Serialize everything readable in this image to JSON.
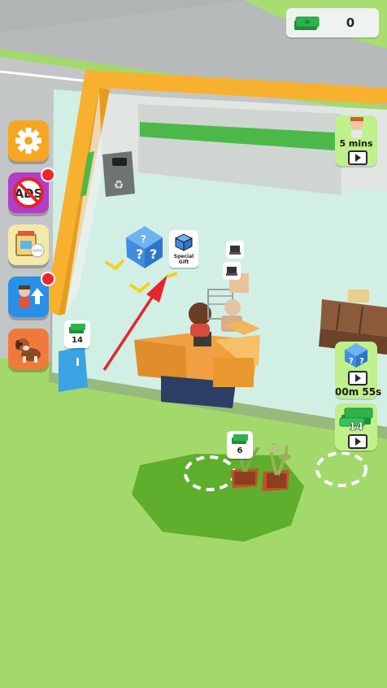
{
  "hud": {
    "cash_amount": "0",
    "cash_icon": "cash-stack-icon"
  },
  "side_menu": [
    {
      "id": "settings",
      "icon": "gear-icon",
      "color": "#f5a623",
      "notification": false
    },
    {
      "id": "no-ads",
      "icon": "no-ads-icon",
      "label": "ADS",
      "color": "#b33dc6",
      "notification": true
    },
    {
      "id": "shop",
      "icon": "shop-icon",
      "color": "#f3e9a8",
      "notification": false
    },
    {
      "id": "upgrade-staff",
      "icon": "staff-upgrade-icon",
      "color": "#2a8fe6",
      "notification": true
    },
    {
      "id": "pet",
      "icon": "dog-icon",
      "color": "#f07a3b",
      "notification": false
    }
  ],
  "rewards": {
    "helper_timer": "5 mins",
    "mystery_box_timer": "00m 55s",
    "cash_reward_amount": "14"
  },
  "world": {
    "gift_label": "Special Gift",
    "counter_price": "14",
    "plant_price": "6"
  },
  "colors": {
    "grass": "#a3d96a",
    "road": "#b9bcbc",
    "floor": "#d2efe5",
    "wall": "#f7b12e",
    "dark_patch": "#5fae2d"
  }
}
